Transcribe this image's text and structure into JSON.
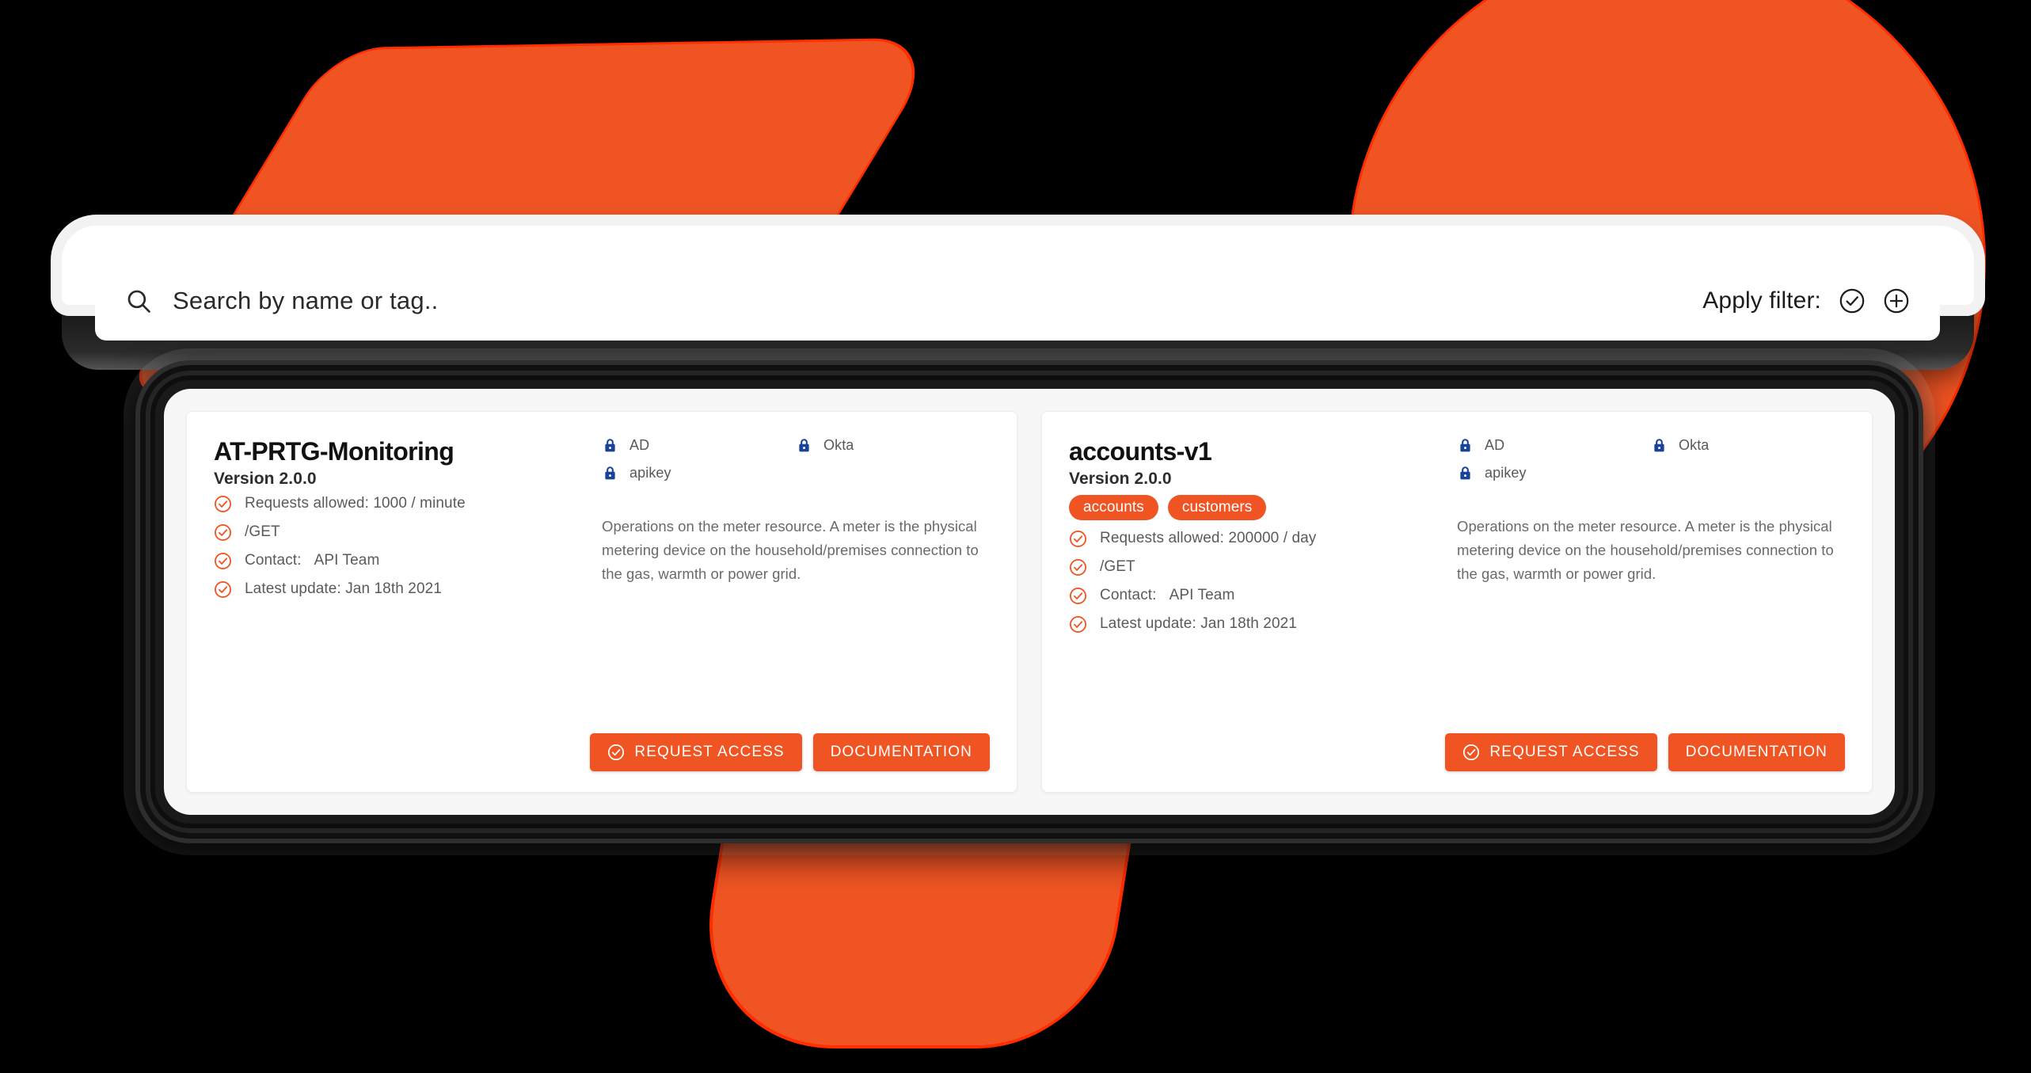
{
  "theme": {
    "accent": "#f05423",
    "accent_outline": "#ff2d00",
    "lock_blue": "#19429b",
    "panel_bg": "#f7f7f7",
    "card_bg": "#ffffff",
    "page_bg": "#000000"
  },
  "search": {
    "placeholder": "Search by name or tag..",
    "value": "",
    "icon": "search-icon",
    "filter_label": "Apply filter:",
    "filter_check_icon": "check-circle-icon",
    "filter_add_icon": "plus-circle-icon"
  },
  "cards": [
    {
      "title": "AT-PRTG-Monitoring",
      "version": "Version 2.0.0",
      "tags": [],
      "features": [
        "Requests allowed: 1000 / minute",
        "/GET"
      ],
      "contact_label": "Contact:",
      "contact_value": "API Team",
      "latest_update": "Latest update: Jan 18th 2021",
      "auth": [
        {
          "icon": "lock-icon",
          "label": "AD"
        },
        {
          "icon": "lock-icon",
          "label": "Okta"
        },
        {
          "icon": "lock-icon",
          "label": "apikey"
        }
      ],
      "description": "Operations on the meter resource. A meter is the physical metering device on the household/premises connection to the gas, warmth or power grid.",
      "request_access_label": "REQUEST ACCESS",
      "documentation_label": "DOCUMENTATION"
    },
    {
      "title": "accounts-v1",
      "version": "Version 2.0.0",
      "tags": [
        "accounts",
        "customers"
      ],
      "features": [
        "Requests allowed: 200000 / day",
        "/GET"
      ],
      "contact_label": "Contact:",
      "contact_value": "API Team",
      "latest_update": "Latest update: Jan 18th 2021",
      "auth": [
        {
          "icon": "lock-icon",
          "label": "AD"
        },
        {
          "icon": "lock-icon",
          "label": "Okta"
        },
        {
          "icon": "lock-icon",
          "label": "apikey"
        }
      ],
      "description": "Operations on the meter resource. A meter is the physical metering device on the household/premises connection to the gas, warmth or power grid.",
      "request_access_label": "REQUEST ACCESS",
      "documentation_label": "DOCUMENTATION"
    }
  ]
}
